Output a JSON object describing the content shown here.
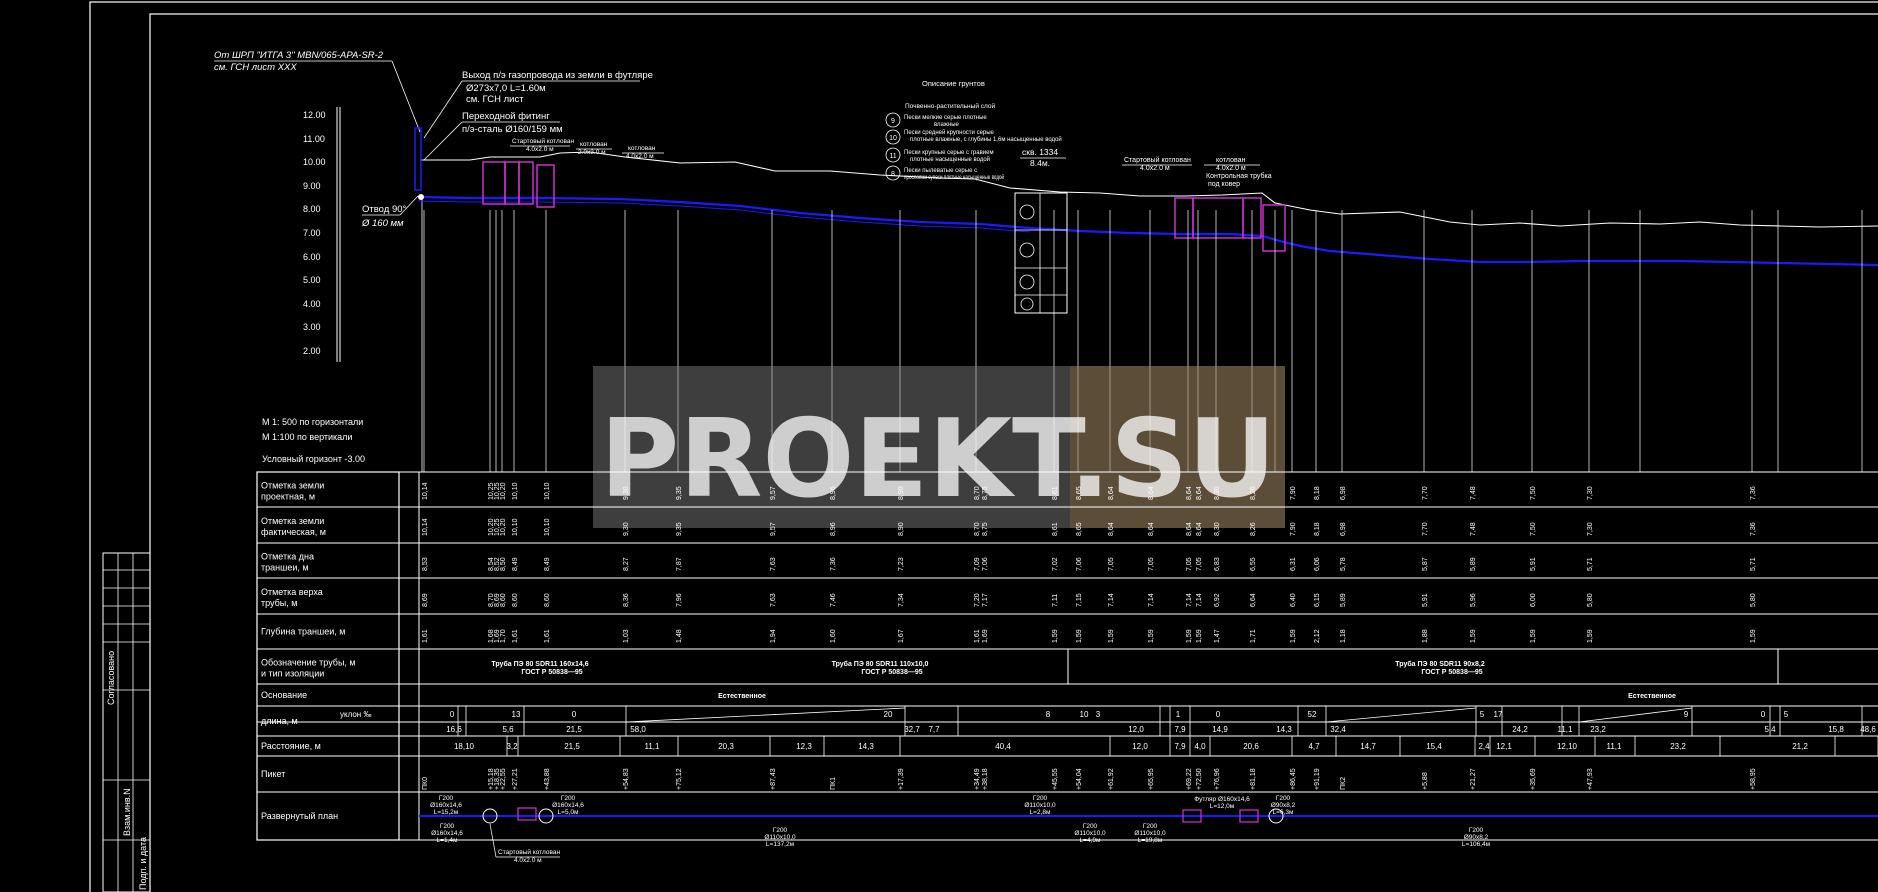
{
  "notes": {
    "source_line1": "От ШРП \"ИТГА 3\" MBN/065-APA-SR-2",
    "source_line2": "см. ГСН лист XXX",
    "exit_line1": "Выход п/э газопровода из земли в футляре",
    "exit_line2": "Ø273х7,0 L=1.60м",
    "exit_line3": "см. ГСН лист",
    "fitting_line1": "Переходной фитинг",
    "fitting_line2": "п/э-сталь Ø160/159 мм",
    "elbow_line1": "Отвод 90°",
    "elbow_line2": "Ø 160 мм",
    "start_pit1_line1": "Стартовый котлован",
    "start_pit1_line2": "4.0х2.0 м",
    "pit_a_line1": "котлован",
    "pit_a_line2": "2.0х2.0 м",
    "pit_b_line1": "котлован",
    "pit_b_line2": "4.0х2.0 м",
    "borehole_line1": "скв. 1334",
    "borehole_line2": "8.4м.",
    "start_pit2_line1": "Стартовый котлован",
    "start_pit2_line2": "4.0х2.0 м",
    "pit_c_line1": "котлован",
    "pit_c_line2": "4.0х2.0 м",
    "pit_c_line3": "Контрольная трубка",
    "pit_c_line4": "под ковер",
    "start_pit3_line1": "Стартовый котлован",
    "start_pit3_line2": "4.0х2.0 м"
  },
  "soil": {
    "title": "Описание грунтов",
    "subtitle": "Почвенно-растительный слой",
    "items": [
      {
        "num": "9",
        "line1": "Пески мелкие серые плотные",
        "line2": "влажные"
      },
      {
        "num": "10",
        "line1": "Пески средней крупности серые",
        "line2": "плотные влажные, с глубины 1,6м насыщенные водой"
      },
      {
        "num": "11",
        "line1": "Пески крупные серые с гравием",
        "line2": "плотные насыщенные водой"
      },
      {
        "num": "8",
        "line1": "Пески пылеватые серые с",
        "line2": "прослоями супеси плотные насыщенные водой"
      }
    ]
  },
  "elevation_scale": {
    "labels": [
      "12.00",
      "11.00",
      "10.00",
      "9.00",
      "8.00",
      "7.00",
      "6.00",
      "5.00",
      "4.00",
      "3.00",
      "2.00"
    ]
  },
  "scale_notes": {
    "horizontal": "М 1: 500  по горизонтали",
    "vertical": "М 1:100   по вертикали",
    "datum": "Условный горизонт   -3.00"
  },
  "table": {
    "rows": [
      {
        "line1": "Отметка  земли",
        "line2": "проектная, м"
      },
      {
        "line1": "Отметка  земли",
        "line2": "фактическая, м"
      },
      {
        "line1": "Отметка дна",
        "line2": "траншеи, м"
      },
      {
        "line1": "Отметка верха",
        "line2": "трубы, м"
      },
      {
        "line1": "Глубина траншеи, м",
        "line2": ""
      },
      {
        "line1": "Обозначение трубы, м",
        "line2": "и тип изоляции"
      },
      {
        "line1": "Основание",
        "line2": ""
      },
      {
        "line1": "длина, м",
        "line2": ""
      },
      {
        "line1": "Расстояние, м",
        "line2": ""
      },
      {
        "line1": "Пикет",
        "line2": ""
      },
      {
        "line1": "Развернутый план",
        "line2": ""
      }
    ],
    "slope_header": "уклон ‰",
    "pipe_labels": [
      {
        "line1": "Труба   ПЭ 80  SDR11 160х14,6",
        "line2": "ГОСТ Р 50838—95"
      },
      {
        "line1": "Труба   ПЭ 80  SDR11 110х10,0",
        "line2": "ГОСТ Р 50838—95"
      },
      {
        "line1": "Труба   ПЭ 80  SDR11 90х8,2",
        "line2": "ГОСТ Р 50838—95"
      }
    ],
    "base_labels": [
      "Естественное",
      "Естественное"
    ],
    "distances": [
      "18,10",
      "3,2",
      "21,5",
      "11,1",
      "20,3",
      "12,3",
      "14,3",
      "40,4",
      "12,0",
      "7,9",
      "4,0",
      "20,6",
      "4,7",
      "14,7",
      "15,4",
      "2,4",
      "12,1",
      "12,10",
      "11,1",
      "23,2",
      "21,2"
    ],
    "lengths": [
      "16,6",
      "5,6",
      "21,5",
      "58,0",
      "32,7",
      "7,7",
      "12,0",
      "7,9",
      "14,9",
      "14,3",
      "32,4",
      "24,2",
      "11,1",
      "23,2",
      "5,4",
      "15,8",
      "48,6"
    ],
    "slopes": [
      "0",
      "13",
      "0",
      "20",
      "8",
      "10",
      "3",
      "1",
      "0",
      "52",
      "17",
      "5",
      "9",
      "0",
      "5"
    ]
  },
  "column_values": {
    "proj": [
      "10,14",
      "10,25",
      "10,25",
      "10,20",
      "10,10",
      "10,10",
      "9,30",
      "9,35",
      "9,57",
      "8,96",
      "8,90",
      "8,70",
      "8,75",
      "8,61",
      "8,65",
      "8,64",
      "8,64",
      "8,64",
      "8,64",
      "8,30",
      "8,26",
      "7,90",
      "8,18",
      "6,98",
      "7,70",
      "7,48",
      "7,50",
      "7,30",
      "7,36"
    ],
    "fact": [
      "10,14",
      "10,20",
      "10,25",
      "10,20",
      "10,10",
      "10,10",
      "9,30",
      "9,35",
      "9,57",
      "8,96",
      "8,90",
      "8,70",
      "8,75",
      "8,61",
      "8,65",
      "8,64",
      "8,64",
      "8,64",
      "8,64",
      "8,30",
      "8,26",
      "7,90",
      "8,18",
      "6,98",
      "7,70",
      "7,48",
      "7,50",
      "7,30",
      "7,36"
    ],
    "bottom": [
      "8,53",
      "8,54",
      "8,52",
      "8,50",
      "8,49",
      "8,49",
      "8,27",
      "7,87",
      "7,63",
      "7,36",
      "7,23",
      "7,09",
      "7,06",
      "7,02",
      "7,06",
      "7,05",
      "7,05",
      "7,05",
      "7,05",
      "6,83",
      "6,55",
      "6,31",
      "6,06",
      "5,78",
      "5,87",
      "5,89",
      "5,91",
      "5,71",
      "5,71"
    ],
    "top": [
      "8,69",
      "8,70",
      "8,69",
      "8,60",
      "8,60",
      "8,60",
      "8,36",
      "7,96",
      "7,63",
      "7,46",
      "7,34",
      "7,20",
      "7,17",
      "7,11",
      "7,15",
      "7,14",
      "7,14",
      "7,14",
      "7,14",
      "6,92",
      "6,64",
      "6,40",
      "6,15",
      "5,89",
      "5,91",
      "5,96",
      "6,00",
      "5,80",
      "5,80"
    ],
    "depth": [
      "1,61",
      "1,68",
      "1,69",
      "1,70",
      "1,61",
      "1,61",
      "1,03",
      "1,48",
      "1,94",
      "1,60",
      "1,67",
      "1,61",
      "1,69",
      "1,59",
      "1,59",
      "1,59",
      "1,59",
      "1,59",
      "1,59",
      "1,47",
      "1,71",
      "1,59",
      "2,12",
      "1,18",
      "1,88",
      "1,59",
      "1,59",
      "1,59",
      "1,59"
    ],
    "picket": [
      "ПК0",
      "+15,18",
      "+18,35",
      "+22,55",
      "+27,21",
      "+43,88",
      "+54,83",
      "+75,12",
      "+87,43",
      "ПК1",
      "+17,39",
      "+34,49",
      "+38,18",
      "+45,55",
      "+54,04",
      "+61,92",
      "+65,95",
      "+69,22",
      "+72,50",
      "+76,96",
      "+81,18",
      "+86,45",
      "+91,19",
      "ПК2",
      "+5,88",
      "+21,27",
      "+35,69",
      "+47,93",
      "+58,95"
    ]
  },
  "plan_labels": [
    {
      "line1": "Г200",
      "line2": "Ø160х14,6",
      "line3": "L=15,2м"
    },
    {
      "line1": "Г200",
      "line2": "Ø160х14,6",
      "line3": "L=1,4м"
    },
    {
      "line1": "Г200",
      "line2": "Ø160х14,6",
      "line3": "L=5,0м"
    },
    {
      "line1": "Г200",
      "line2": "Ø110х10,0",
      "line3": "L=137,2м"
    },
    {
      "line1": "Г200",
      "line2": "Ø110х10,0",
      "line3": "L=2,8м"
    },
    {
      "line1": "Г200",
      "line2": "Ø110х10,0",
      "line3": "L=4,9м"
    },
    {
      "line1": "Г200",
      "line2": "Ø110х10,0",
      "line3": "L=19,8м"
    },
    {
      "line1": "Футляр  Ø160х14,6",
      "line2": "L=12,0м",
      "line3": ""
    },
    {
      "line1": "Г200",
      "line2": "Ø90х8,2",
      "line3": "L=6,3м"
    },
    {
      "line1": "Г200",
      "line2": "Ø90х8,2",
      "line3": "L=106,4м"
    }
  ],
  "title_block": {
    "agreed": "Согласовано",
    "inv": "Взам.инв.N",
    "sign": "Подп. и дата"
  },
  "watermark": {
    "text": "PROEKT.SU"
  },
  "colors": {
    "background": "#000000",
    "lines": "#ffffff",
    "pipe": "#1a1aff",
    "pit": "#d633d6",
    "watermark": "#8a8a8a"
  }
}
